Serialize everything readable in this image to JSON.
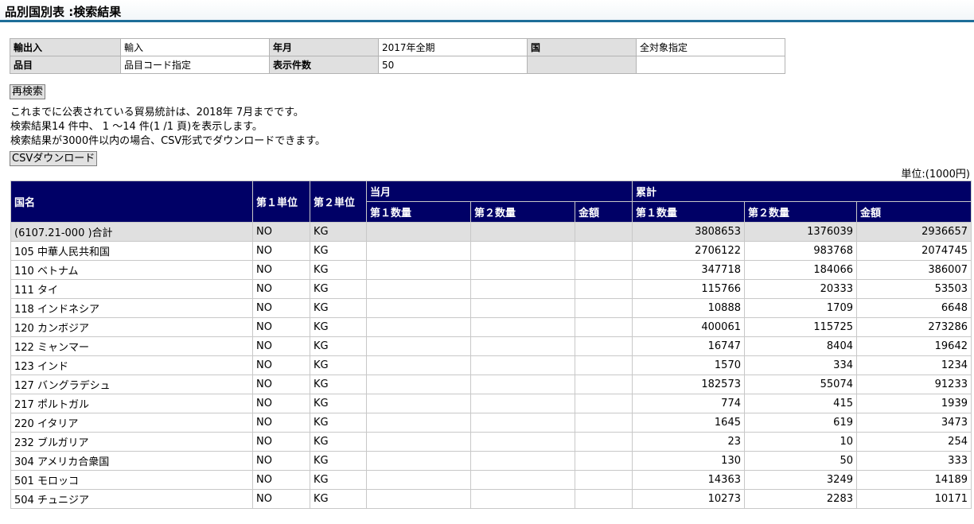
{
  "page_title": "品別国別表 :検索結果",
  "conditions": {
    "row1": {
      "l1": "輸出入",
      "v1": "輸入",
      "l2": "年月",
      "v2": "2017年全期",
      "l3": "国",
      "v3": "全対象指定"
    },
    "row2": {
      "l1": "品目",
      "v1": "品目コード指定",
      "l2": "表示件数",
      "v2": "50",
      "l3": "",
      "v3": ""
    }
  },
  "research_button": "再検索",
  "info": {
    "line1": "これまでに公表されている貿易統計は、2018年 7月までです。",
    "line2": "検索結果14 件中、 1 ～14 件(1 /1 頁)を表示します。",
    "line3": "検索結果が3000件以内の場合、CSV形式でダウンロードできます。"
  },
  "csv_button": "CSVダウンロード",
  "unit_label": "単位:(1000円)",
  "table": {
    "headers": {
      "country": "国名",
      "unit1": "第１単位",
      "unit2": "第２単位",
      "current_month": "当月",
      "cumulative": "累計",
      "qty1": "第１数量",
      "qty2": "第２数量",
      "amount": "金額"
    },
    "rows": [
      {
        "country": "(6107.21-000 )合計",
        "u1": "NO",
        "u2": "KG",
        "m_q1": "",
        "m_q2": "",
        "m_amt": "",
        "c_q1": "3808653",
        "c_q2": "1376039",
        "c_amt": "2936657"
      },
      {
        "country": "105 中華人民共和国",
        "u1": "NO",
        "u2": "KG",
        "m_q1": "",
        "m_q2": "",
        "m_amt": "",
        "c_q1": "2706122",
        "c_q2": "983768",
        "c_amt": "2074745"
      },
      {
        "country": "110 ベトナム",
        "u1": "NO",
        "u2": "KG",
        "m_q1": "",
        "m_q2": "",
        "m_amt": "",
        "c_q1": "347718",
        "c_q2": "184066",
        "c_amt": "386007"
      },
      {
        "country": "111 タイ",
        "u1": "NO",
        "u2": "KG",
        "m_q1": "",
        "m_q2": "",
        "m_amt": "",
        "c_q1": "115766",
        "c_q2": "20333",
        "c_amt": "53503"
      },
      {
        "country": "118 インドネシア",
        "u1": "NO",
        "u2": "KG",
        "m_q1": "",
        "m_q2": "",
        "m_amt": "",
        "c_q1": "10888",
        "c_q2": "1709",
        "c_amt": "6648"
      },
      {
        "country": "120 カンボジア",
        "u1": "NO",
        "u2": "KG",
        "m_q1": "",
        "m_q2": "",
        "m_amt": "",
        "c_q1": "400061",
        "c_q2": "115725",
        "c_amt": "273286"
      },
      {
        "country": "122 ミャンマー",
        "u1": "NO",
        "u2": "KG",
        "m_q1": "",
        "m_q2": "",
        "m_amt": "",
        "c_q1": "16747",
        "c_q2": "8404",
        "c_amt": "19642"
      },
      {
        "country": "123 インド",
        "u1": "NO",
        "u2": "KG",
        "m_q1": "",
        "m_q2": "",
        "m_amt": "",
        "c_q1": "1570",
        "c_q2": "334",
        "c_amt": "1234"
      },
      {
        "country": "127 バングラデシュ",
        "u1": "NO",
        "u2": "KG",
        "m_q1": "",
        "m_q2": "",
        "m_amt": "",
        "c_q1": "182573",
        "c_q2": "55074",
        "c_amt": "91233"
      },
      {
        "country": "217 ポルトガル",
        "u1": "NO",
        "u2": "KG",
        "m_q1": "",
        "m_q2": "",
        "m_amt": "",
        "c_q1": "774",
        "c_q2": "415",
        "c_amt": "1939"
      },
      {
        "country": "220 イタリア",
        "u1": "NO",
        "u2": "KG",
        "m_q1": "",
        "m_q2": "",
        "m_amt": "",
        "c_q1": "1645",
        "c_q2": "619",
        "c_amt": "3473"
      },
      {
        "country": "232 ブルガリア",
        "u1": "NO",
        "u2": "KG",
        "m_q1": "",
        "m_q2": "",
        "m_amt": "",
        "c_q1": "23",
        "c_q2": "10",
        "c_amt": "254"
      },
      {
        "country": "304 アメリカ合衆国",
        "u1": "NO",
        "u2": "KG",
        "m_q1": "",
        "m_q2": "",
        "m_amt": "",
        "c_q1": "130",
        "c_q2": "50",
        "c_amt": "333"
      },
      {
        "country": "501 モロッコ",
        "u1": "NO",
        "u2": "KG",
        "m_q1": "",
        "m_q2": "",
        "m_amt": "",
        "c_q1": "14363",
        "c_q2": "3249",
        "c_amt": "14189"
      },
      {
        "country": "504 チュニジア",
        "u1": "NO",
        "u2": "KG",
        "m_q1": "",
        "m_q2": "",
        "m_amt": "",
        "c_q1": "10273",
        "c_q2": "2283",
        "c_amt": "10171"
      }
    ]
  },
  "colors": {
    "header_bg": "#000066",
    "header_rule": "#1d6e99",
    "label_bg": "#e0e0e0"
  }
}
